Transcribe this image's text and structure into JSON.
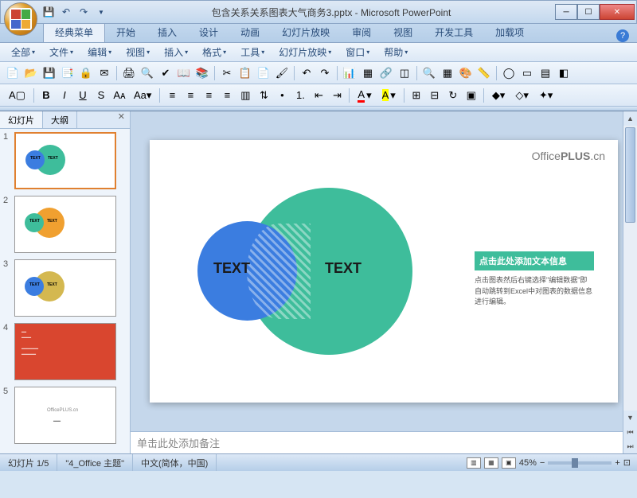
{
  "title": "包含关系关系图表大气商务3.pptx - Microsoft PowerPoint",
  "ribbon_tabs": [
    "经典菜单",
    "开始",
    "插入",
    "设计",
    "动画",
    "幻灯片放映",
    "审阅",
    "视图",
    "开发工具",
    "加载项"
  ],
  "active_ribbon_tab": 0,
  "classic_menu": [
    "全部",
    "文件",
    "编辑",
    "视图",
    "插入",
    "格式",
    "工具",
    "幻灯片放映",
    "窗口",
    "帮助"
  ],
  "thumb_tabs": {
    "slides": "幻灯片",
    "outline": "大纲"
  },
  "slide": {
    "watermark_prefix": "Office",
    "watermark_bold": "PLUS",
    "watermark_suffix": ".cn",
    "text1": "TEXT",
    "text2": "TEXT",
    "info_title": "点击此处添加文本信息",
    "info_body": "点击图表然后右键选择\"编辑数据\"即自动跳转到Excel中对图表的数据信息进行编辑。"
  },
  "notes_placeholder": "单击此处添加备注",
  "status": {
    "slide_count": "幻灯片 1/5",
    "theme": "\"4_Office 主题\"",
    "lang": "中文(简体，中国)",
    "zoom": "45%"
  },
  "colors": {
    "teal": "#3ebd9b",
    "blue": "#3b7de0",
    "orange": "#f0a030",
    "yellow": "#d4b850",
    "red": "#d9462f"
  },
  "thumbnails": [
    {
      "c1": "#3ebd9b",
      "c2": "#3b7de0"
    },
    {
      "c1": "#f0a030",
      "c2": "#3ebd9b"
    },
    {
      "c1": "#d4b850",
      "c2": "#3b7de0"
    }
  ]
}
